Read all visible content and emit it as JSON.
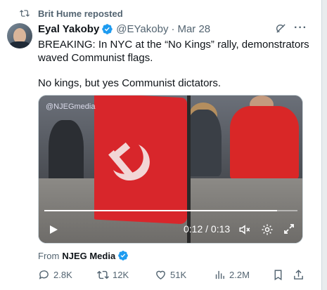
{
  "repost": {
    "label": "Brit Hume reposted",
    "icon": "repost-icon"
  },
  "tweet": {
    "author_name": "Eyal Yakoby",
    "handle": "@EYakoby",
    "separator": "·",
    "date": "Mar 28",
    "verified_color": "#1d9bf0",
    "text_line1": "BREAKING: In NYC at the “No Kings” rally, demonstrators waved Communist flags.",
    "text_line2": "No kings, but yes Communist dictators."
  },
  "video": {
    "watermark": "@NJEGmedia",
    "current_time": "0:12",
    "time_separator": "/",
    "duration": "0:13",
    "progress": 0.92,
    "flag_color": "#d8262b"
  },
  "source": {
    "prefix": "From",
    "name": "NJEG Media"
  },
  "actions": {
    "replies": "2.8K",
    "reposts": "12K",
    "likes": "51K",
    "views": "2.2M"
  },
  "colors": {
    "muted": "#536471",
    "text": "#0f1419",
    "accent": "#1d9bf0"
  }
}
